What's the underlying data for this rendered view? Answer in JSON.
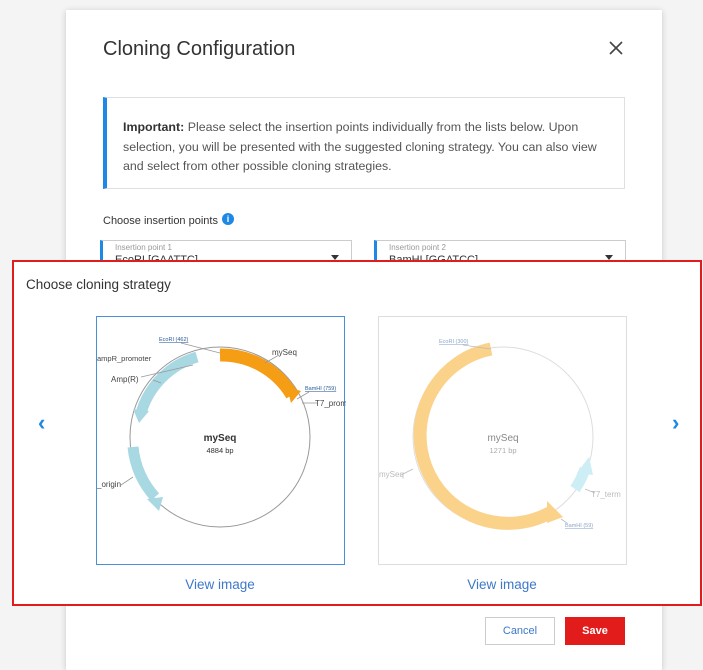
{
  "dialog": {
    "title": "Cloning Configuration",
    "notice_bold": "Important:",
    "notice_text": " Please select the insertion points individually from the lists below. Upon selection, you will be presented with the suggested cloning strategy. You can also view and select from other possible cloning strategies.",
    "insertion_label": "Choose insertion points",
    "insertion_points": [
      {
        "label": "Insertion point 1",
        "value": "EcoRI [GAATTC]"
      },
      {
        "label": "Insertion point 2",
        "value": "BamHI [GGATCC]"
      }
    ]
  },
  "strategy": {
    "title": "Choose cloning strategy",
    "cards": [
      {
        "name": "mySeq",
        "size": "4884 bp",
        "link": "View image",
        "labels": [
          "EcoRI (462)",
          "mySeq",
          "ampR_promoter",
          "Amp(R)",
          "BamHI (759)",
          "T7_prom",
          "_origin"
        ]
      },
      {
        "name": "mySeq",
        "size": "1271 bp",
        "link": "View image",
        "labels": [
          "EcoRI (300)",
          "mySeq",
          "T7_term",
          "BamHI (59)"
        ]
      }
    ]
  },
  "footer": {
    "cancel": "Cancel",
    "save": "Save"
  },
  "colors": {
    "accent": "#1e88e5",
    "danger": "#e21b1b",
    "link": "#3d78c9",
    "plasmid_orange": "#f59d15",
    "plasmid_teal": "#a8d8e2"
  }
}
